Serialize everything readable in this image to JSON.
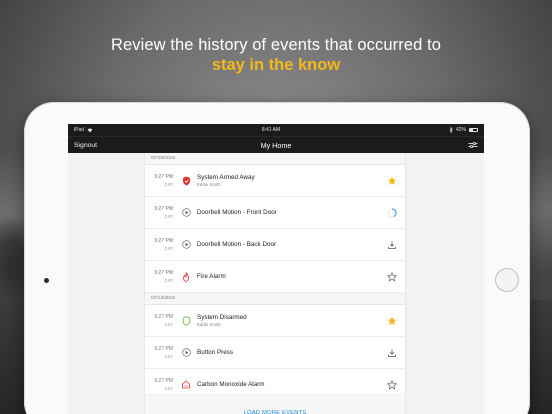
{
  "marketing": {
    "headline": "Review the history of events that occurred  to",
    "headline_accent": "stay in the know",
    "accent_color": "#f5b81c"
  },
  "status_bar": {
    "device": "iPad",
    "time": "8:41 AM",
    "battery": "42%"
  },
  "nav": {
    "left_label": "Signout",
    "title": "My Home",
    "right_icon": "settings-sliders-icon"
  },
  "history": {
    "groups": [
      {
        "date": "07/15/2016",
        "events": [
          {
            "time": "9:27 PM",
            "tz": "CST",
            "icon": "shield-armed-icon",
            "title": "System Armed Away",
            "subtitle": "Eddie Smith",
            "action_icon": "star-filled-icon"
          },
          {
            "time": "9:27 PM",
            "tz": "CST",
            "icon": "play-icon",
            "title": "Doorbell Motion - Front Door",
            "subtitle": "",
            "action_icon": "loading-spinner-icon"
          },
          {
            "time": "9:27 PM",
            "tz": "CST",
            "icon": "play-icon",
            "title": "Doorbell Motion - Back Door",
            "subtitle": "",
            "action_icon": "download-icon"
          },
          {
            "time": "9:27 PM",
            "tz": "CST",
            "icon": "fire-icon",
            "title": "Fire Alarm",
            "subtitle": "",
            "action_icon": "star-outline-icon"
          }
        ]
      },
      {
        "date": "07/14/2016",
        "events": [
          {
            "time": "9:27 PM",
            "tz": "CST",
            "icon": "shield-disarmed-icon",
            "title": "System Disarmed",
            "subtitle": "Eddie Smith",
            "action_icon": "star-filled-icon"
          },
          {
            "time": "9:27 PM",
            "tz": "CST",
            "icon": "play-icon",
            "title": "Button Press",
            "subtitle": "",
            "action_icon": "download-icon"
          },
          {
            "time": "9:27 PM",
            "tz": "CST",
            "icon": "co-alarm-icon",
            "title": "Carbon Monoxide Alarm",
            "subtitle": "",
            "action_icon": "star-outline-icon"
          }
        ]
      }
    ],
    "load_more_label": "LOAD MORE EVENTS"
  },
  "colors": {
    "alarm_red": "#e0312f",
    "disarmed_green": "#5fb83a",
    "link_blue": "#1f8de0",
    "star_yellow": "#f5b81c"
  }
}
